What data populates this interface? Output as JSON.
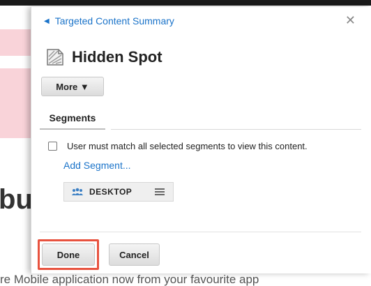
{
  "background": {
    "heading_fragment": "bu",
    "footer_text": "re Mobile application now from your favourite app"
  },
  "panel": {
    "back_link": "Targeted Content Summary",
    "title": "Hidden Spot",
    "more_button": "More ▼",
    "tabs": [
      {
        "label": "Segments"
      }
    ],
    "match_all_label": "User must match all selected segments to view this content.",
    "add_segment": "Add Segment...",
    "segments": [
      {
        "label": "DESKTOP",
        "icon": "people-icon"
      }
    ],
    "done_label": "Done",
    "cancel_label": "Cancel"
  },
  "colors": {
    "link": "#1a73c9",
    "highlight": "#e8523f",
    "background_pink": "#f9d3d9"
  },
  "icons": {
    "back": "left-caret-icon",
    "close": "close-icon",
    "page": "document-icon",
    "segment": "people-icon",
    "segment_menu": "hamburger-icon"
  }
}
